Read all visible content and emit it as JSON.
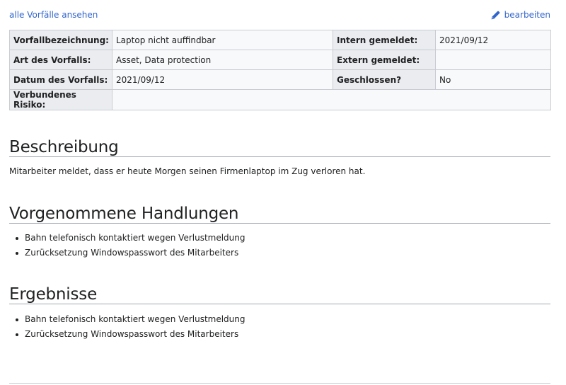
{
  "nav": {
    "back_label": "alle Vorfälle ansehen",
    "edit_label": "bearbeiten",
    "edit_icon": "pencil-icon"
  },
  "info": {
    "vorfallbezeichnung_label": "Vorfallbezeichnung:",
    "vorfallbezeichnung_value": "Laptop nicht auffindbar",
    "intern_label": "Intern gemeldet:",
    "intern_value": "2021/09/12",
    "art_label": "Art des Vorfalls:",
    "art_value": "Asset, Data protection",
    "extern_label": "Extern gemeldet:",
    "extern_value": "",
    "datum_label": "Datum des Vorfalls:",
    "datum_value": "2021/09/12",
    "geschlossen_label": "Geschlossen?",
    "geschlossen_value": "No",
    "risiko_label": "Verbundenes Risiko:",
    "risiko_value": ""
  },
  "beschreibung": {
    "heading": "Beschreibung",
    "text": "Mitarbeiter meldet, dass er heute Morgen seinen Firmenlaptop im Zug verloren hat."
  },
  "handlungen": {
    "heading": "Vorgenommene Handlungen",
    "items": [
      "Bahn telefonisch kontaktiert wegen Verlustmeldung",
      "Zurücksetzung Windowspasswort des Mitarbeiters"
    ]
  },
  "ergebnisse": {
    "heading": "Ergebnisse",
    "items": [
      "Bahn telefonisch kontaktiert wegen Verlustmeldung",
      "Zurücksetzung Windowspasswort des Mitarbeiters"
    ]
  },
  "colors": {
    "link": "#3366cc",
    "label_bg": "#eaecf0",
    "value_bg": "#f8f9fa",
    "border": "#c8ccd1"
  }
}
